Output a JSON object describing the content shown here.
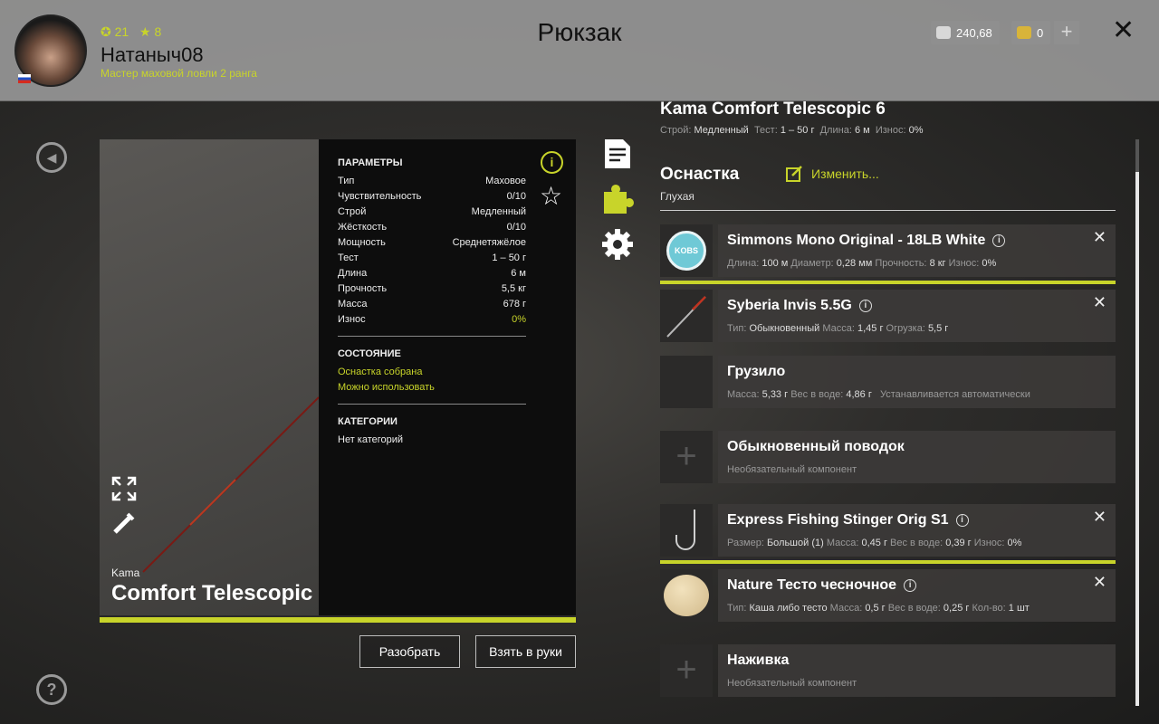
{
  "header": {
    "title": "Рюкзак",
    "stat_coins": "21",
    "stat_stars": "8",
    "username": "Натаныч08",
    "rank": "Мастер маховой ловли 2 ранга",
    "silver": "240,68",
    "gold": "0",
    "plus": "+",
    "close": "✕"
  },
  "rod": {
    "brand": "Kama",
    "name": "Comfort Telescopic",
    "name_suffix": "6"
  },
  "params": {
    "heading": "ПАРАМЕТРЫ",
    "rows": [
      {
        "label": "Тип",
        "value": "Маховое"
      },
      {
        "label": "Чувствительность",
        "value": "0/10"
      },
      {
        "label": "Строй",
        "value": "Медленный"
      },
      {
        "label": "Жёсткость",
        "value": "0/10"
      },
      {
        "label": "Мощность",
        "value": "Среднетяжёлое"
      },
      {
        "label": "Тест",
        "value": "1 – 50 г"
      },
      {
        "label": "Длина",
        "value": "6 м"
      },
      {
        "label": "Прочность",
        "value": "5,5 кг"
      },
      {
        "label": "Масса",
        "value": "678 г"
      },
      {
        "label": "Износ",
        "value": "0%"
      }
    ],
    "state_heading": "СОСТОЯНИЕ",
    "state_1": "Оснастка собрана",
    "state_2": "Можно использовать",
    "cat_heading": "КАТЕГОРИИ",
    "cat_value": "Нет категорий"
  },
  "buttons": {
    "disassemble": "Разобрать",
    "take": "Взять в руки"
  },
  "right": {
    "title": "Kama Comfort Telescopic 6",
    "stroi_label": "Строй:",
    "stroi": "Медленный",
    "test_label": "Тест:",
    "test": "1 – 50 г",
    "len_label": "Длина:",
    "len": "6 м",
    "wear_label": "Износ:",
    "wear": "0%",
    "osnastka": "Оснастка",
    "edit": "Изменить...",
    "rig_type": "Глухая"
  },
  "components": {
    "line": {
      "name": "Simmons Mono Original - 18LB White",
      "l1": "Длина:",
      "v1": "100 м",
      "l2": "Диаметр:",
      "v2": "0,28 мм",
      "l3": "Прочность:",
      "v3": "8 кг",
      "l4": "Износ:",
      "v4": "0%",
      "thumb": "KOBS"
    },
    "float": {
      "name": "Syberia Invis 5.5G",
      "l1": "Тип:",
      "v1": "Обыкновенный",
      "l2": "Масса:",
      "v2": "1,45 г",
      "l3": "Огрузка:",
      "v3": "5,5 г"
    },
    "sinker": {
      "name": "Грузило",
      "l1": "Масса:",
      "v1": "5,33 г",
      "l2": "Вес в воде:",
      "v2": "4,86 г",
      "note": "Устанавливается автоматически"
    },
    "leader": {
      "name": "Обыкновенный поводок",
      "note": "Необязательный компонент"
    },
    "hook": {
      "name": "Express Fishing Stinger Orig S1",
      "l1": "Размер:",
      "v1": "Большой (1)",
      "l2": "Масса:",
      "v2": "0,45 г",
      "l3": "Вес в воде:",
      "v3": "0,39 г",
      "l4": "Износ:",
      "v4": "0%"
    },
    "bait": {
      "name": "Nature Тесто чесночное",
      "l1": "Тип:",
      "v1": "Каша либо тесто",
      "l2": "Масса:",
      "v2": "0,5 г",
      "l3": "Вес в воде:",
      "v3": "0,25 г",
      "l4": "Кол-во:",
      "v4": "1 шт"
    },
    "attractant": {
      "name": "Наживка",
      "note": "Необязательный компонент"
    }
  },
  "colors": {
    "accent": "#c8d42a"
  }
}
